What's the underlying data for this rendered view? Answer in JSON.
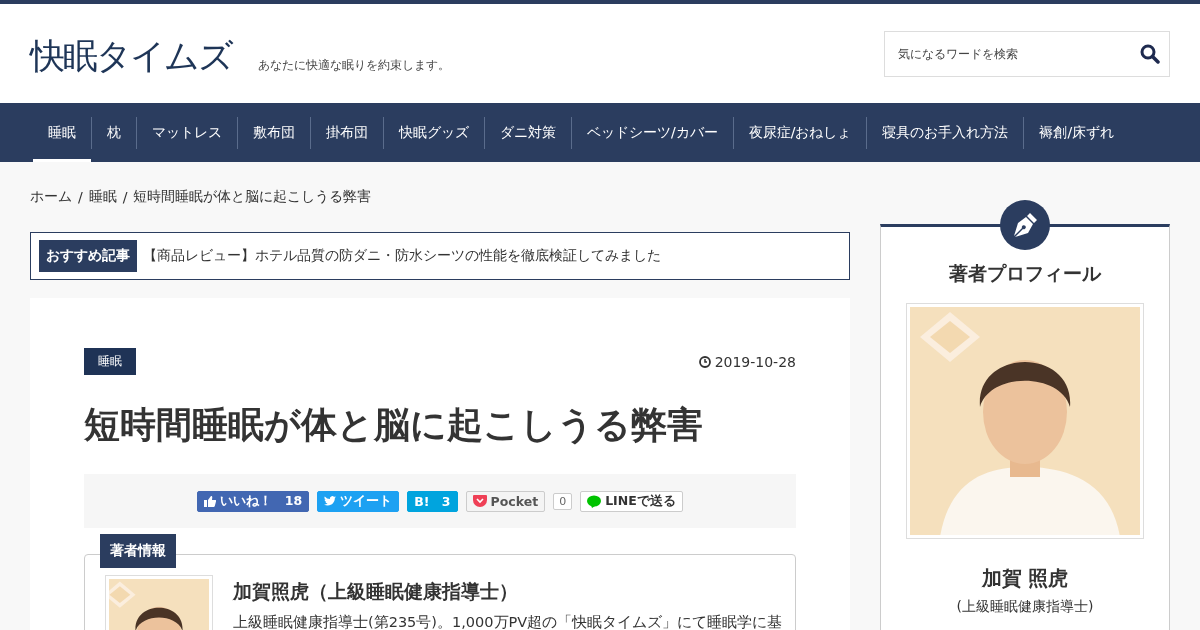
{
  "header": {
    "logo": "快眠タイムズ",
    "tagline": "あなたに快適な眠りを約束します。",
    "search": {
      "placeholder": "気になるワードを検索"
    }
  },
  "nav": [
    {
      "label": "睡眠",
      "selected": true
    },
    {
      "label": "枕",
      "selected": false
    },
    {
      "label": "マットレス",
      "selected": false
    },
    {
      "label": "敷布団",
      "selected": false
    },
    {
      "label": "掛布団",
      "selected": false
    },
    {
      "label": "快眠グッズ",
      "selected": false
    },
    {
      "label": "ダニ対策",
      "selected": false
    },
    {
      "label": "ベッドシーツ/カバー",
      "selected": false
    },
    {
      "label": "夜尿症/おねしょ",
      "selected": false
    },
    {
      "label": "寝具のお手入れ方法",
      "selected": false
    },
    {
      "label": "褥創/床ずれ",
      "selected": false
    }
  ],
  "breadcrumb": [
    "ホーム",
    "睡眠",
    "短時間睡眠が体と脳に起こしうる弊害"
  ],
  "breadcrumb_separator": "/",
  "recommend": {
    "label": "おすすめ記事",
    "text": "【商品レビュー】ホテル品質の防ダニ・防水シーツの性能を徹底検証してみました"
  },
  "article": {
    "category": "睡眠",
    "date": "2019-10-28",
    "title": "短時間睡眠が体と脳に起こしうる弊害",
    "share": [
      {
        "kind": "facebook",
        "label": "いいね！",
        "count": "18"
      },
      {
        "kind": "twitter",
        "label": "ツイート"
      },
      {
        "kind": "hatena",
        "label": "B!",
        "count": "3"
      },
      {
        "kind": "pocket",
        "label": "Pocket",
        "count": "0"
      },
      {
        "kind": "line",
        "label": "LINEで送る"
      }
    ],
    "author": {
      "tab": "著者情報",
      "name": "加賀照虎（上級睡眠健康指導士）",
      "bio": "上級睡眠健康指導士(第235号)。1,000万PV超の「快眠タイムズ」にて睡眠学に基"
    }
  },
  "sidebar": {
    "title": "著者プロフィール",
    "name": "加賀 照虎",
    "role": "(上級睡眠健康指導士)"
  }
}
